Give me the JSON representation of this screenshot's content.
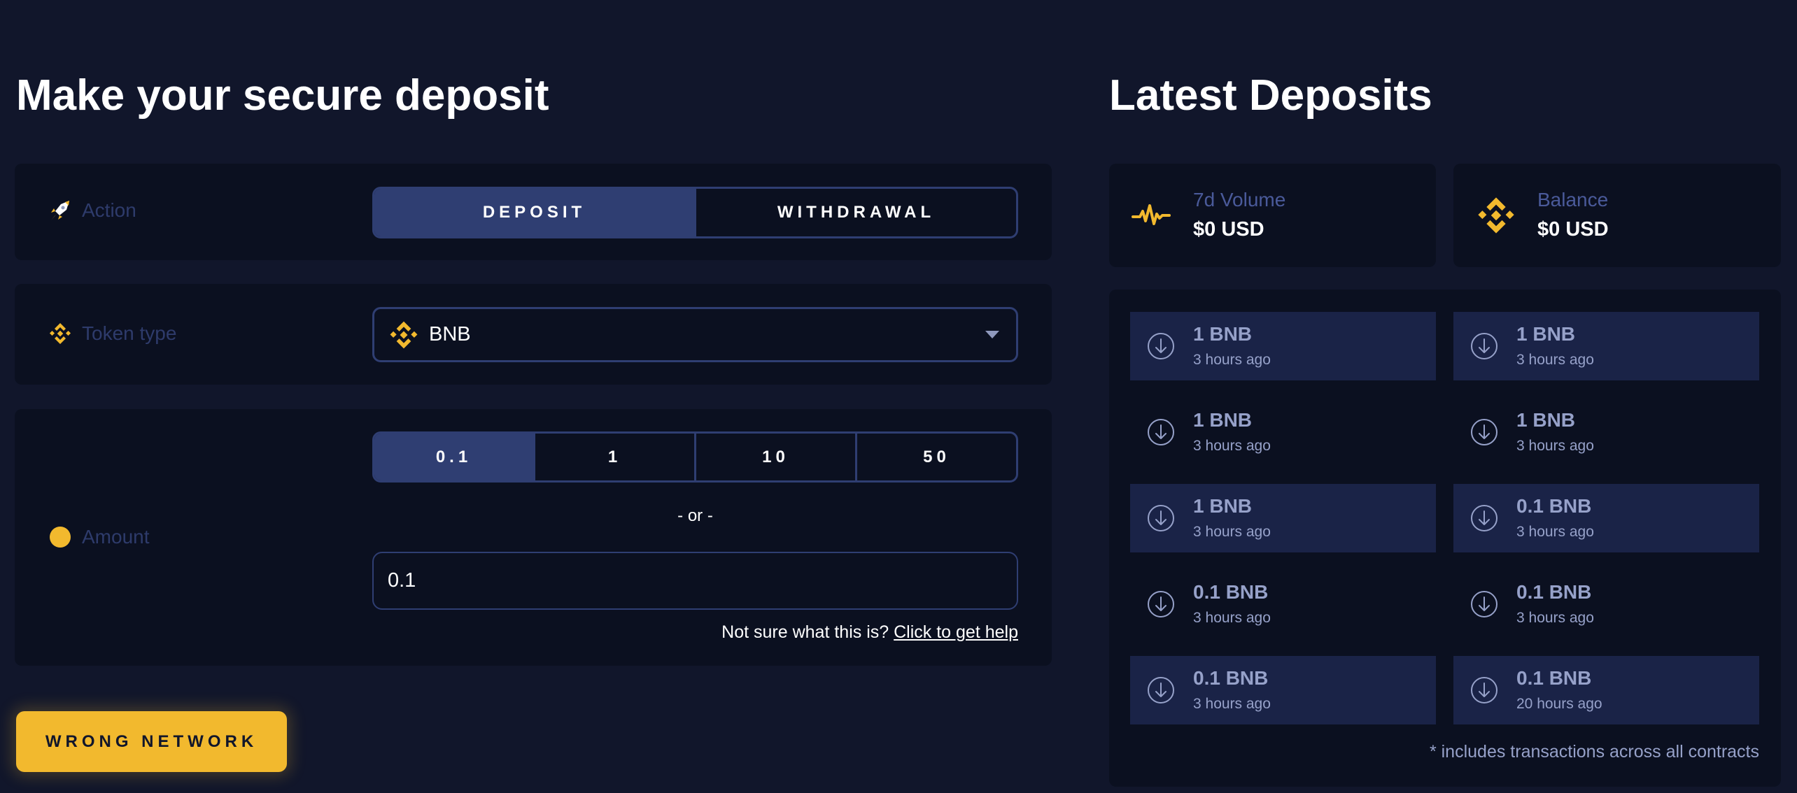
{
  "left": {
    "title": "Make your secure deposit",
    "action": {
      "label": "Action",
      "icon": "rocket-icon",
      "options": [
        {
          "label": "DEPOSIT",
          "active": true
        },
        {
          "label": "WITHDRAWAL",
          "active": false
        }
      ]
    },
    "token": {
      "label": "Token type",
      "icon": "bnb-icon",
      "selected": "BNB"
    },
    "amount": {
      "label": "Amount",
      "icon": "coin-icon",
      "options": [
        {
          "label": "0.1",
          "active": true
        },
        {
          "label": "1",
          "active": false
        },
        {
          "label": "10",
          "active": false
        },
        {
          "label": "50",
          "active": false
        }
      ],
      "or_text": "- or -",
      "input_value": "0.1",
      "help_prefix": "Not sure what this is?",
      "help_link": "Click to get help"
    },
    "submit_label": "WRONG NETWORK"
  },
  "right": {
    "title": "Latest Deposits",
    "stats": [
      {
        "label": "7d Volume",
        "value": "$0 USD",
        "icon": "pulse-icon"
      },
      {
        "label": "Balance",
        "value": "$0 USD",
        "icon": "bnb-icon"
      }
    ],
    "deposits": [
      {
        "amount": "1 BNB",
        "time": "3 hours ago"
      },
      {
        "amount": "1 BNB",
        "time": "3 hours ago"
      },
      {
        "amount": "1 BNB",
        "time": "3 hours ago"
      },
      {
        "amount": "1 BNB",
        "time": "3 hours ago"
      },
      {
        "amount": "1 BNB",
        "time": "3 hours ago"
      },
      {
        "amount": "0.1 BNB",
        "time": "3 hours ago"
      },
      {
        "amount": "0.1 BNB",
        "time": "3 hours ago"
      },
      {
        "amount": "0.1 BNB",
        "time": "3 hours ago"
      },
      {
        "amount": "0.1 BNB",
        "time": "3 hours ago"
      },
      {
        "amount": "0.1 BNB",
        "time": "20 hours ago"
      }
    ],
    "footnote": "* includes transactions across all contracts"
  },
  "colors": {
    "background": "#11162b",
    "card": "#0b1020",
    "accent": "#2f3e72",
    "warning": "#f2b92e",
    "row_highlight": "#1a2347",
    "muted_text": "#96a1c9"
  }
}
